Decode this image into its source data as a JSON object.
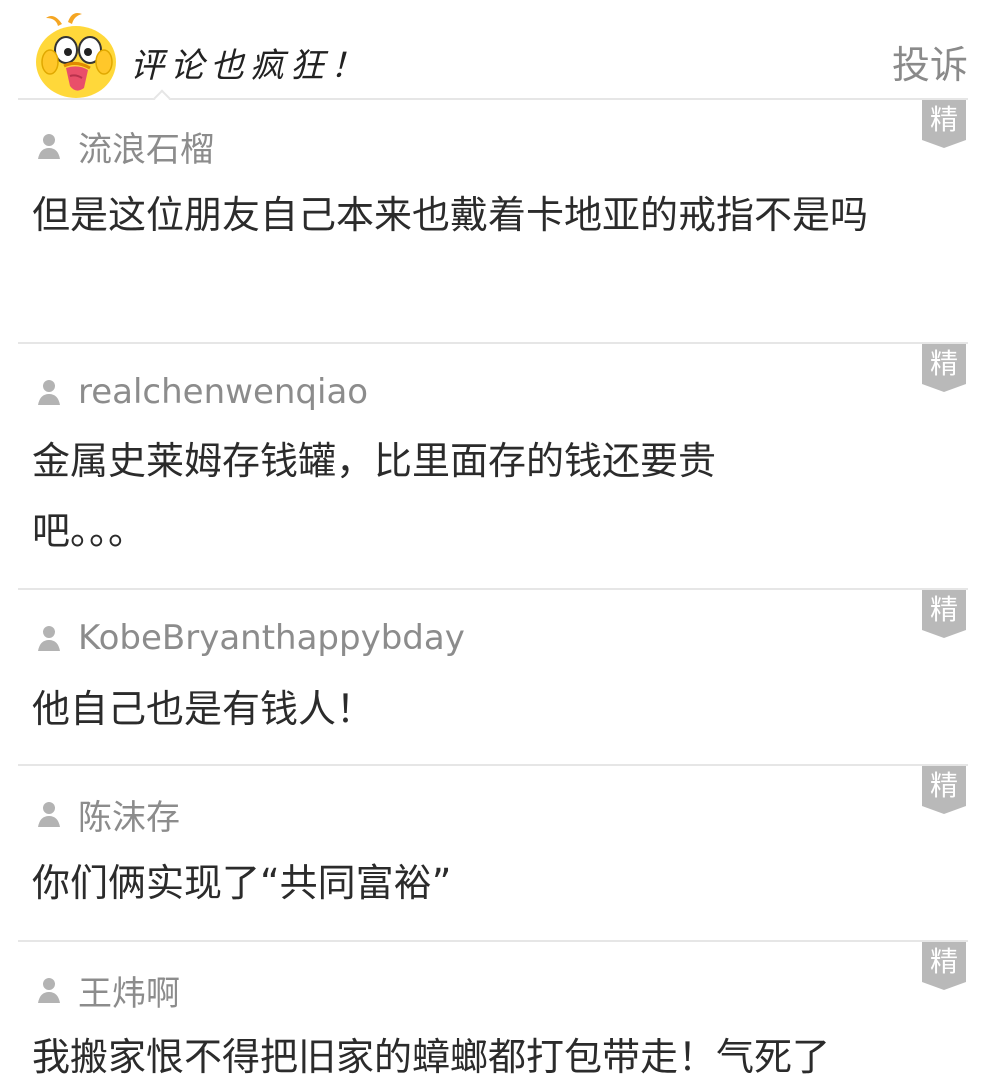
{
  "header": {
    "title": "评论也疯狂！",
    "complaint_label": "投诉"
  },
  "colors": {
    "divider": "#e6e6e6",
    "badge": "#b9b9b9",
    "muted_text": "#8c8c8c",
    "body_text": "#2b2b2b"
  },
  "icons": {
    "mascot": "yellow-chick-mascot-icon",
    "user": "user-silhouette-icon"
  },
  "comments": [
    {
      "badge": "精",
      "author": "流浪石榴",
      "text": "但是这位朋友自己本来也戴着卡地亚的戒指不是吗"
    },
    {
      "badge": "精",
      "author": "realchenwenqiao",
      "text": "金属史莱姆存钱罐，比里面存的钱还要贵吧。。。"
    },
    {
      "badge": "精",
      "author": "KobeBryanthappybday",
      "text": "他自己也是有钱人！"
    },
    {
      "badge": "精",
      "author": "陈沫存",
      "text": "你们俩实现了“共同富裕”"
    },
    {
      "badge": "精",
      "author": "王炜啊",
      "text": "我搬家恨不得把旧家的蟑螂都打包带走！气死了"
    }
  ]
}
